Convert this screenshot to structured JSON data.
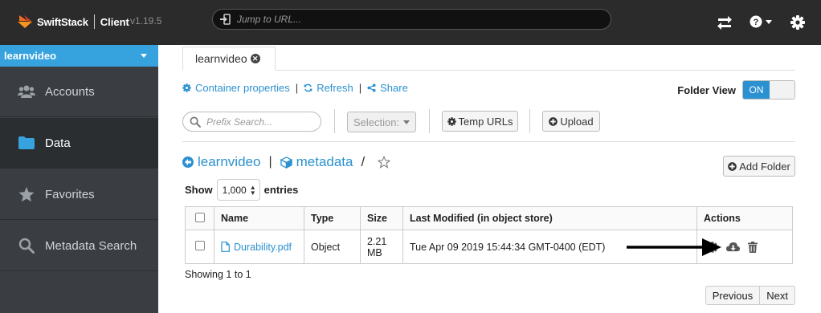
{
  "topbar": {
    "brand_name": "SwiftStack",
    "brand_product": "Client",
    "version": "v1.19.5",
    "url_placeholder": "Jump to URL...",
    "icons": [
      "transfers-icon",
      "help-icon",
      "settings-gear-icon"
    ]
  },
  "sidebar": {
    "account": "learnvideo",
    "items": [
      {
        "label": "Accounts",
        "icon": "users-icon"
      },
      {
        "label": "Data",
        "icon": "folder-icon",
        "active": true
      },
      {
        "label": "Favorites",
        "icon": "star-icon"
      },
      {
        "label": "Metadata Search",
        "icon": "search-icon"
      }
    ]
  },
  "main": {
    "tab_label": "learnvideo",
    "links": {
      "container_properties": "Container properties",
      "refresh": "Refresh",
      "share": "Share"
    },
    "folder_view": {
      "label": "Folder View",
      "state": "ON"
    },
    "toolbar": {
      "prefix_placeholder": "Prefix Search...",
      "selection": "Selection:",
      "temp_urls": "Temp URLs",
      "upload": "Upload"
    },
    "breadcrumb": {
      "account": "learnvideo",
      "container": "metadata",
      "slash": "/"
    },
    "add_folder": "Add Folder",
    "show_entries": {
      "show": "Show",
      "value": "1,000",
      "entries": "entries"
    },
    "table": {
      "columns": [
        "Name",
        "Type",
        "Size",
        "Last Modified (in object store)",
        "Actions"
      ],
      "rows": [
        {
          "name": "Durability.pdf",
          "type": "Object",
          "size_line1": "2.21",
          "size_line2": "MB",
          "modified": "Tue Apr 09 2019 15:44:34 GMT-0400 (EDT)"
        }
      ]
    },
    "showing": "Showing 1 to 1",
    "pager": {
      "previous": "Previous",
      "next": "Next"
    }
  },
  "colors": {
    "topbar_bg": "#2b2b2b",
    "sidebar_bg": "#3a3e42",
    "accent": "#36a3df",
    "link": "#2b91d0"
  }
}
